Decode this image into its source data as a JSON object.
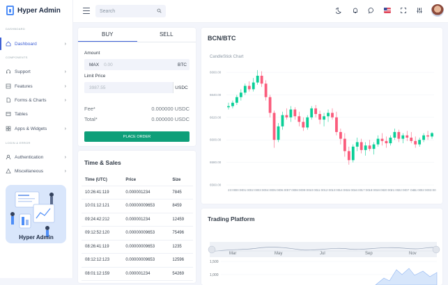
{
  "brand": {
    "name": "Hyper Admin",
    "accent": "#3e60d5"
  },
  "sidebar": {
    "caption_main": "DASHBOARD",
    "caption_components": "COMPONENTS",
    "caption_login": "LOGIN & ERROR",
    "items": [
      {
        "label": "Dashboard",
        "icon": "home-icon"
      },
      {
        "label": "Support",
        "icon": "headset-icon"
      },
      {
        "label": "Features",
        "icon": "grid-icon"
      },
      {
        "label": "Forms & Charts",
        "icon": "file-icon"
      },
      {
        "label": "Tables",
        "icon": "table-icon"
      },
      {
        "label": "Apps & Widgets",
        "icon": "apps-icon"
      },
      {
        "label": "Authentication",
        "icon": "user-icon"
      },
      {
        "label": "Miscellaneous",
        "icon": "triangle-icon"
      }
    ],
    "promo_title": "Hyper Admin"
  },
  "topbar": {
    "search_placeholder": "Search"
  },
  "trade": {
    "tabs": [
      "BUY",
      "SELL"
    ],
    "amount_label": "Amount",
    "amount_prefix": "MAX",
    "amount_placeholder": "0.00",
    "amount_unit": "BTC",
    "limit_label": "Limit Price",
    "limit_placeholder": "3987.55",
    "limit_unit": "USDC",
    "fee_label": "Fee*",
    "fee_value": "0.000000 USDC",
    "total_label": "Total*",
    "total_value": "0.000000 USDC",
    "button": "PLACE ORDER"
  },
  "time_sales": {
    "title": "Time & Sales",
    "headers": [
      "Time (UTC)",
      "Price",
      "Size"
    ],
    "rows": [
      {
        "time": "10:26:41:119",
        "price": "0.000001234",
        "size": "7845",
        "dir": "up"
      },
      {
        "time": "10:01:12:121",
        "price": "0.00000009653",
        "size": "8459",
        "dir": "down"
      },
      {
        "time": "09:24:42:212",
        "price": "0.000001234",
        "size": "12459",
        "dir": "up"
      },
      {
        "time": "09:12:52:120",
        "price": "0.00000009653",
        "size": "75496",
        "dir": "down"
      },
      {
        "time": "08:26:41:119",
        "price": "0.00000009653",
        "size": "1235",
        "dir": "down"
      },
      {
        "time": "08:12:12:123",
        "price": "0.00000009653",
        "size": "12596",
        "dir": "down"
      },
      {
        "time": "08:01:12:159",
        "price": "0.000001234",
        "size": "54269",
        "dir": "up"
      }
    ]
  },
  "candle": {
    "title": "BCN/BTC",
    "subtitle": "CandleStick Chart",
    "colors": {
      "up": "#0acf97",
      "down": "#fa5c7c"
    }
  },
  "platform": {
    "title": "Trading Platform",
    "months": [
      "Mar",
      "May",
      "Jul",
      "Sep",
      "Nov"
    ],
    "y_label": "1,500",
    "y_label2": "1,000"
  },
  "chart_data": {
    "type": "candlestick",
    "title": "CandleStick Chart",
    "y_ticks": [
      "6660.00",
      "6640.00",
      "6620.00",
      "6600.00",
      "6580.00",
      "6560.00"
    ],
    "ylim": [
      6560,
      6665
    ],
    "x_ticks": [
      "23:00",
      "00:00",
      "01:00",
      "02:00",
      "03:00",
      "04:00",
      "05:00",
      "06:00",
      "07:00",
      "08:00",
      "09:00",
      "10:00",
      "11:00",
      "12:00",
      "13:00",
      "14:00",
      "15:00",
      "16:00",
      "17:00",
      "18:00",
      "19:00",
      "20:00",
      "21:00",
      "22:00",
      "07 Oct",
      "01:00",
      "02:00",
      "03:00"
    ],
    "ohlc": [
      [
        6629,
        6633,
        6627,
        6630
      ],
      [
        6630,
        6635,
        6628,
        6633
      ],
      [
        6633,
        6640,
        6631,
        6638
      ],
      [
        6638,
        6645,
        6635,
        6642
      ],
      [
        6642,
        6650,
        6640,
        6648
      ],
      [
        6648,
        6652,
        6643,
        6645
      ],
      [
        6645,
        6655,
        6643,
        6651
      ],
      [
        6651,
        6662,
        6649,
        6657
      ],
      [
        6657,
        6661,
        6647,
        6650
      ],
      [
        6650,
        6653,
        6635,
        6638
      ],
      [
        6638,
        6640,
        6620,
        6624
      ],
      [
        6624,
        6626,
        6593,
        6600
      ],
      [
        6600,
        6615,
        6598,
        6612
      ],
      [
        6612,
        6625,
        6609,
        6622
      ],
      [
        6622,
        6628,
        6618,
        6620
      ],
      [
        6620,
        6630,
        6616,
        6627
      ],
      [
        6627,
        6629,
        6618,
        6621
      ],
      [
        6621,
        6625,
        6612,
        6616
      ],
      [
        6616,
        6620,
        6608,
        6611
      ],
      [
        6611,
        6622,
        6609,
        6620
      ],
      [
        6620,
        6630,
        6618,
        6628
      ],
      [
        6628,
        6631,
        6620,
        6623
      ],
      [
        6623,
        6626,
        6614,
        6618
      ],
      [
        6618,
        6624,
        6612,
        6621
      ],
      [
        6621,
        6627,
        6616,
        6624
      ],
      [
        6624,
        6628,
        6618,
        6620
      ],
      [
        6620,
        6625,
        6604,
        6607
      ],
      [
        6607,
        6610,
        6596,
        6601
      ],
      [
        6601,
        6606,
        6585,
        6590
      ],
      [
        6590,
        6594,
        6578,
        6582
      ],
      [
        6582,
        6596,
        6580,
        6594
      ],
      [
        6594,
        6602,
        6590,
        6598
      ],
      [
        6598,
        6601,
        6588,
        6591
      ],
      [
        6591,
        6598,
        6586,
        6595
      ],
      [
        6595,
        6600,
        6590,
        6592
      ],
      [
        6592,
        6598,
        6587,
        6596
      ],
      [
        6596,
        6604,
        6594,
        6601
      ],
      [
        6601,
        6606,
        6595,
        6599
      ],
      [
        6599,
        6603,
        6593,
        6597
      ],
      [
        6597,
        6604,
        6595,
        6602
      ],
      [
        6602,
        6610,
        6600,
        6607
      ],
      [
        6607,
        6609,
        6598,
        6601
      ],
      [
        6601,
        6606,
        6597,
        6604
      ],
      [
        6604,
        6608,
        6599,
        6602
      ],
      [
        6602,
        6607,
        6597,
        6599
      ],
      [
        6599,
        6603,
        6593,
        6596
      ],
      [
        6596,
        6602,
        6594,
        6600
      ],
      [
        6600,
        6606,
        6598,
        6604
      ],
      [
        6604,
        6608,
        6600,
        6603
      ],
      [
        6603,
        6607,
        6601,
        6606
      ]
    ]
  }
}
